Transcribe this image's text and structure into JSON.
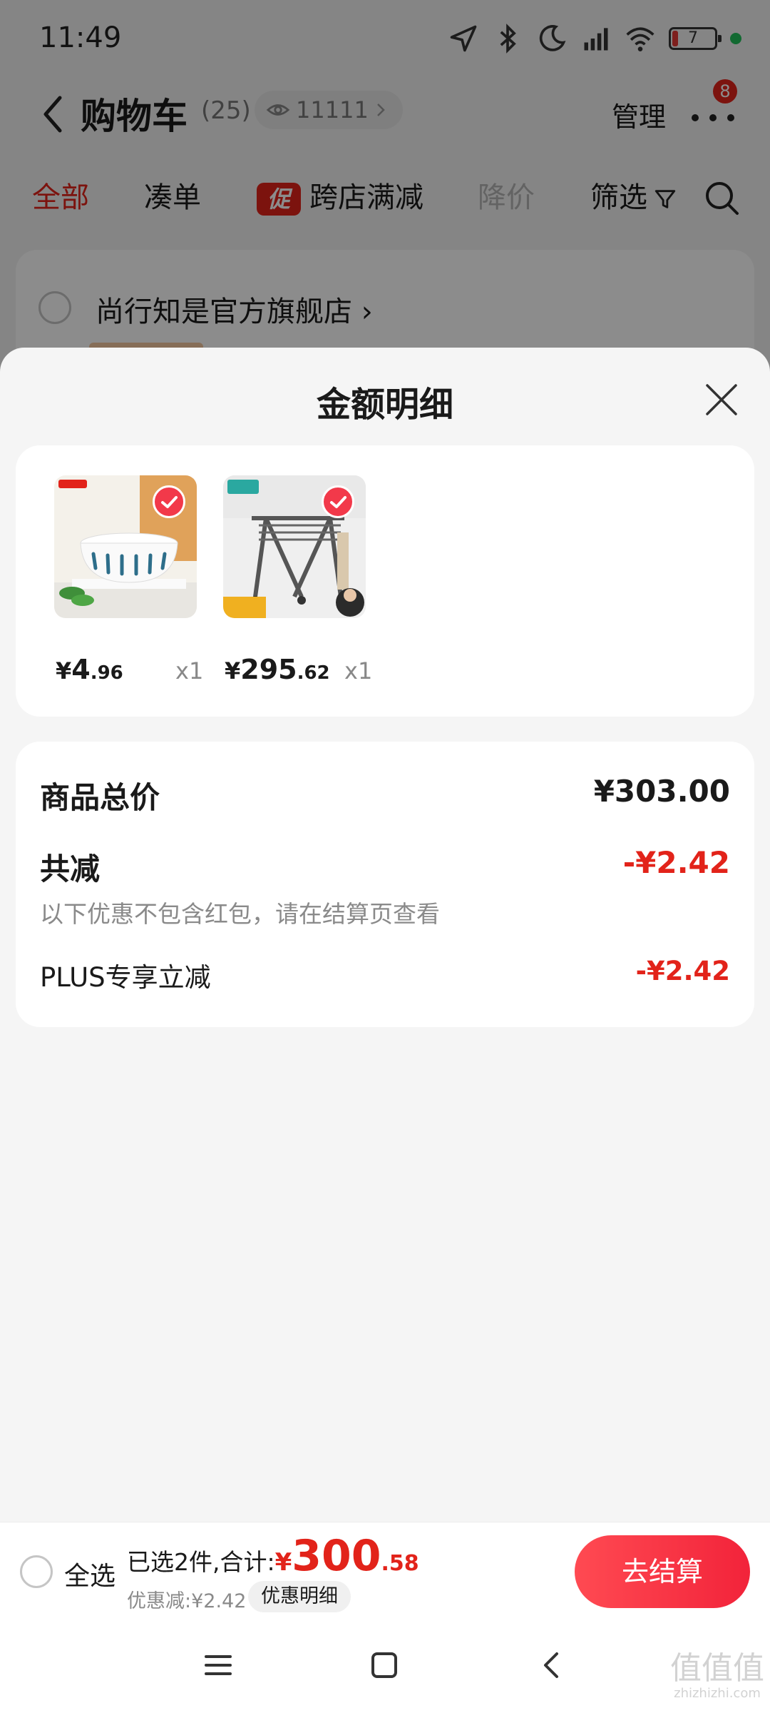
{
  "status_bar": {
    "time": "11:49",
    "battery": "7",
    "icons": [
      "location-icon",
      "bluetooth-icon",
      "moon-icon",
      "signal-hd-icon",
      "wifi-icon",
      "battery-icon"
    ]
  },
  "header": {
    "title": "购物车",
    "count": "(25)",
    "watch_count": "11111",
    "manage_label": "管理",
    "more_badge": "8"
  },
  "tabs": [
    {
      "label": "全部",
      "state": "active"
    },
    {
      "label": "凑单",
      "state": "normal"
    },
    {
      "label": "跨店满减",
      "state": "normal",
      "badge": "促"
    },
    {
      "label": "降价",
      "state": "disabled"
    },
    {
      "label": "筛选",
      "state": "normal"
    }
  ],
  "store": {
    "name": "尚行知是官方旗舰店 ›"
  },
  "sheet": {
    "title": "金额明细",
    "products": [
      {
        "currency": "¥",
        "price_int": "4",
        "price_dec": ".96",
        "qty": "x1",
        "image": "bowl"
      },
      {
        "currency": "¥",
        "price_int": "295",
        "price_dec": ".62",
        "qty": "x1",
        "image": "clothes-rack"
      }
    ],
    "summary": {
      "total_label": "商品总价",
      "total_value": "¥303.00",
      "reduce_label": "共减",
      "reduce_value": "-¥2.42",
      "note": "以下优惠不包含红包，请在结算页查看",
      "plus_label": "PLUS专享立减",
      "plus_value": "-¥2.42"
    }
  },
  "checkout": {
    "select_all": "全选",
    "selected_prefix": "已选2件,合计:",
    "total_currency": "¥",
    "total_int": "300",
    "total_dec": ".58",
    "discount_text": "优惠减:¥2.42",
    "discount_detail": "优惠明细",
    "button": "去结算"
  },
  "watermark": {
    "main": "值值值",
    "sub": "zhizhizhi.com"
  },
  "colors": {
    "accent": "#e2231a",
    "checkout_gradient": "#ff4a52",
    "price_text": "#1a1a1a"
  }
}
